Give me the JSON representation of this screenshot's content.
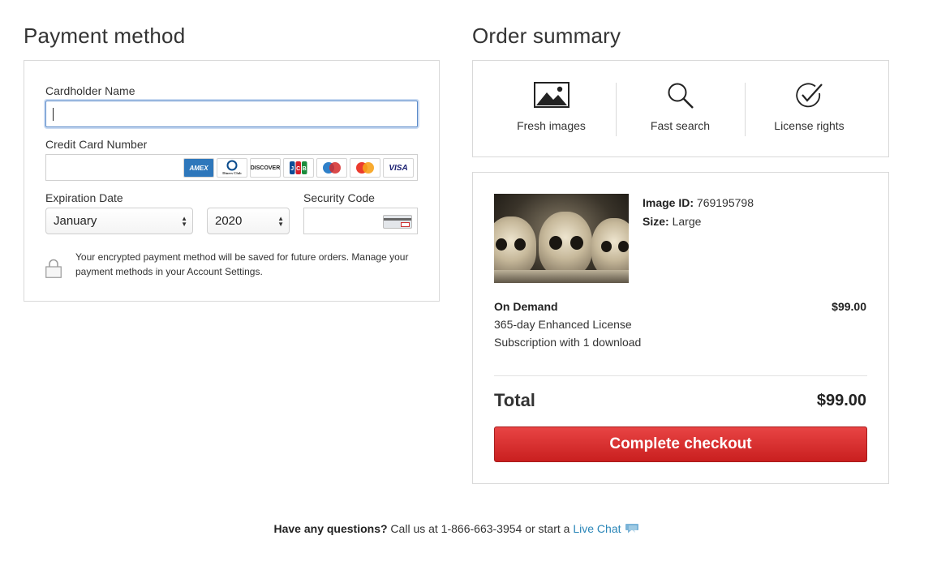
{
  "payment": {
    "title": "Payment method",
    "cardholder_label": "Cardholder Name",
    "cardholder_value": "",
    "card_number_label": "Credit Card Number",
    "card_number_value": "",
    "card_brands": [
      "AMEX",
      "Diners Club",
      "DISCOVER",
      "JCB",
      "Maestro",
      "MasterCard",
      "VISA"
    ],
    "expiration_label": "Expiration Date",
    "month_value": "January",
    "year_value": "2020",
    "security_label": "Security Code",
    "security_value": "",
    "save_note": "Your encrypted payment method will be saved for future orders. Manage your payment methods in your Account Settings."
  },
  "summary": {
    "title": "Order summary",
    "benefits": [
      {
        "label": "Fresh images",
        "icon": "image-icon"
      },
      {
        "label": "Fast search",
        "icon": "search-icon"
      },
      {
        "label": "License rights",
        "icon": "checkmark-circle-icon"
      }
    ],
    "image_id_label": "Image ID:",
    "image_id_value": "769195798",
    "size_label": "Size:",
    "size_value": "Large",
    "product_name": "On Demand",
    "product_price": "$99.00",
    "product_line1": "365-day Enhanced License",
    "product_line2": "Subscription with 1 download",
    "total_label": "Total",
    "total_value": "$99.00",
    "checkout_label": "Complete checkout"
  },
  "help": {
    "question": "Have any questions?",
    "call_text": " Call us at 1-866-663-3954 or start a ",
    "chat_label": "Live Chat"
  },
  "colors": {
    "checkout_button": "#d32f2f",
    "link": "#2a86b8",
    "focus_border": "#5b8bc9"
  }
}
